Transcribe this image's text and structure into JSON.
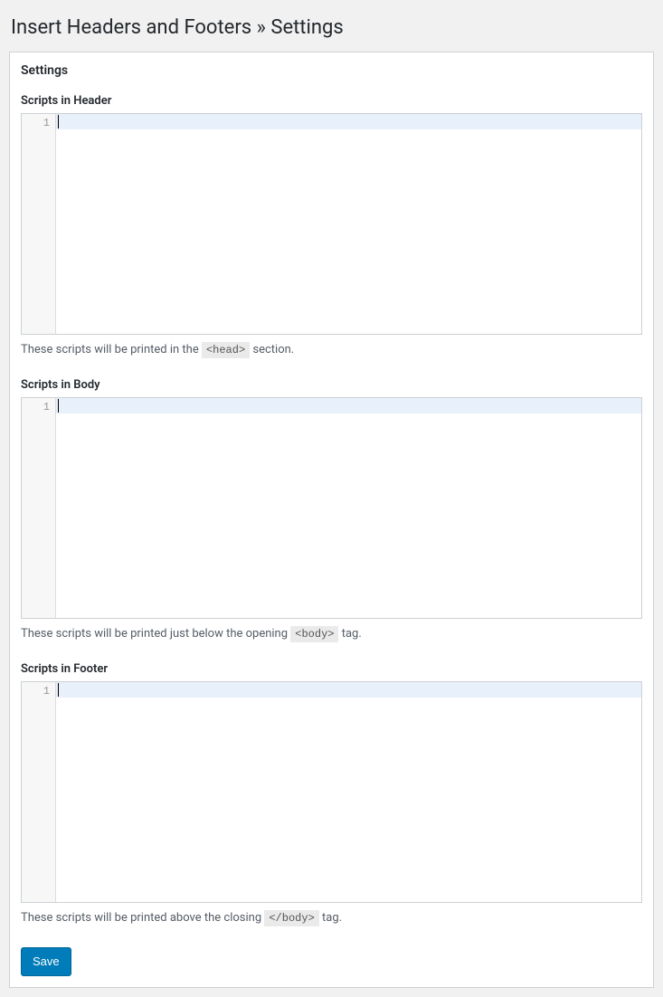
{
  "page": {
    "title": "Insert Headers and Footers » Settings"
  },
  "box": {
    "heading": "Settings"
  },
  "fields": {
    "header": {
      "label": "Scripts in Header",
      "helpPrefix": "These scripts will be printed in the ",
      "helpTag": "<head>",
      "helpSuffix": " section.",
      "lineNumber": "1"
    },
    "body": {
      "label": "Scripts in Body",
      "helpPrefix": "These scripts will be printed just below the opening ",
      "helpTag": "<body>",
      "helpSuffix": " tag.",
      "lineNumber": "1"
    },
    "footer": {
      "label": "Scripts in Footer",
      "helpPrefix": "These scripts will be printed above the closing ",
      "helpTag": "</body>",
      "helpSuffix": " tag.",
      "lineNumber": "1"
    }
  },
  "buttons": {
    "save": "Save"
  }
}
